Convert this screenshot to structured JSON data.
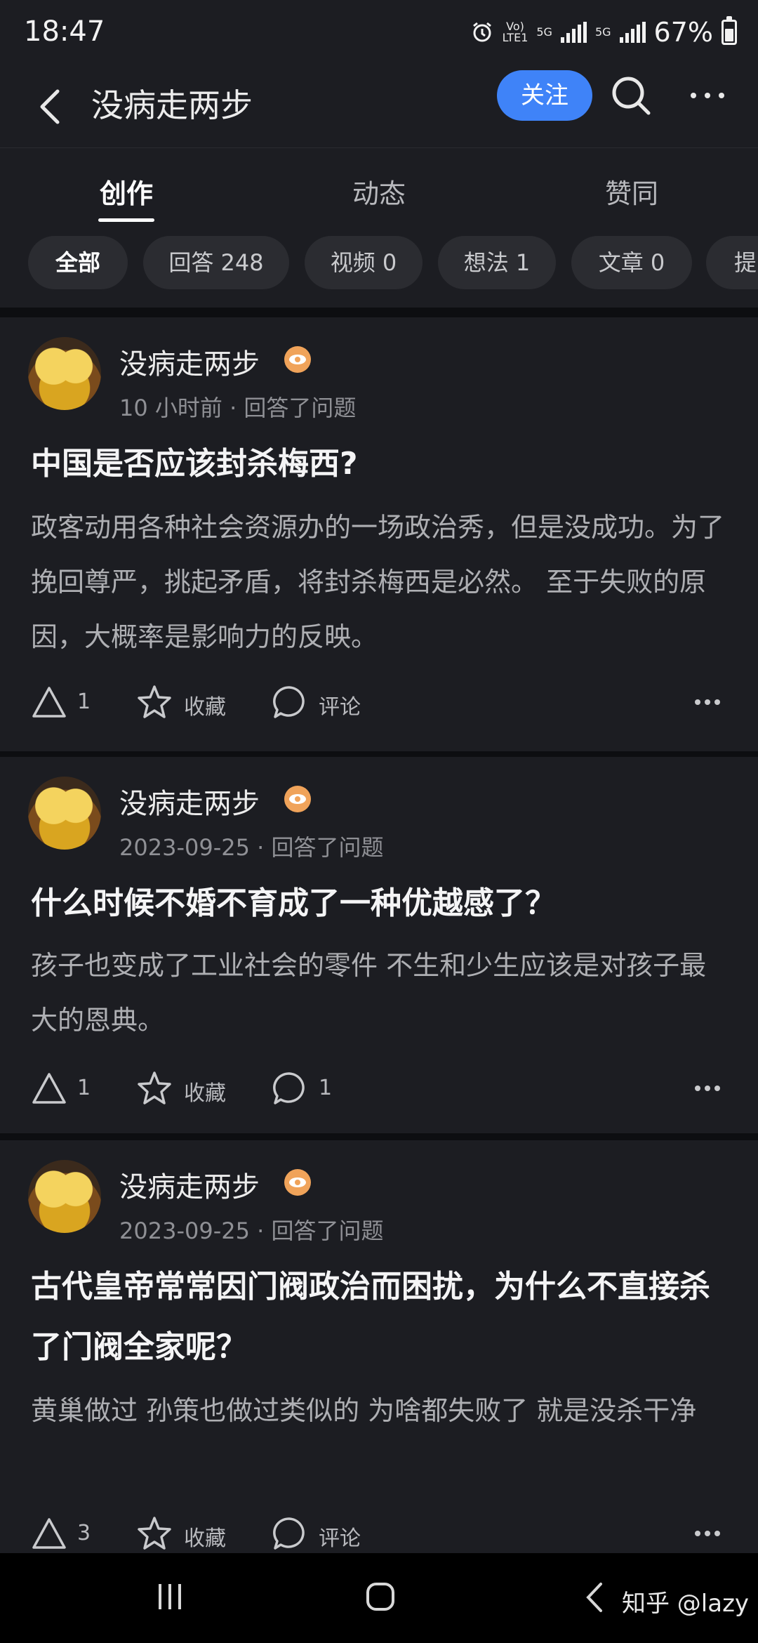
{
  "status": {
    "time": "18:47",
    "net1": "Vo)\nLTE1",
    "net2": "5G",
    "net3": "5G",
    "battery": "67%"
  },
  "header": {
    "title": "没病走两步",
    "follow_label": "关注"
  },
  "tabs": [
    {
      "label": "创作"
    },
    {
      "label": "动态"
    },
    {
      "label": "赞同"
    }
  ],
  "chips": [
    {
      "label": "全部"
    },
    {
      "label": "回答 248"
    },
    {
      "label": "视频 0"
    },
    {
      "label": "想法 1"
    },
    {
      "label": "文章 0"
    },
    {
      "label": "提"
    }
  ],
  "posts": [
    {
      "author": "没病走两步",
      "meta": "10 小时前 · 回答了问题",
      "title": "中国是否应该封杀梅西?",
      "excerpt": "政客动用各种社会资源办的一场政治秀，但是没成功。为了挽回尊严，挑起矛盾，将封杀梅西是必然。 至于失败的原因，大概率是影响力的反映。",
      "likes": "1",
      "collect": "收藏",
      "comment": "评论"
    },
    {
      "author": "没病走两步",
      "meta": "2023-09-25 · 回答了问题",
      "title": "什么时候不婚不育成了一种优越感了？",
      "excerpt": "孩子也变成了工业社会的零件 不生和少生应该是对孩子最大的恩典。",
      "likes": "1",
      "collect": "收藏",
      "comment": "1"
    },
    {
      "author": "没病走两步",
      "meta": "2023-09-25 · 回答了问题",
      "title": "古代皇帝常常因门阀政治而困扰，为什么不直接杀了门阀全家呢？",
      "excerpt": "黄巢做过 孙策也做过类似的 为啥都失败了 就是没杀干净",
      "likes": "3",
      "collect": "收藏",
      "comment": "评论"
    }
  ],
  "watermark": "知乎 @lazy"
}
